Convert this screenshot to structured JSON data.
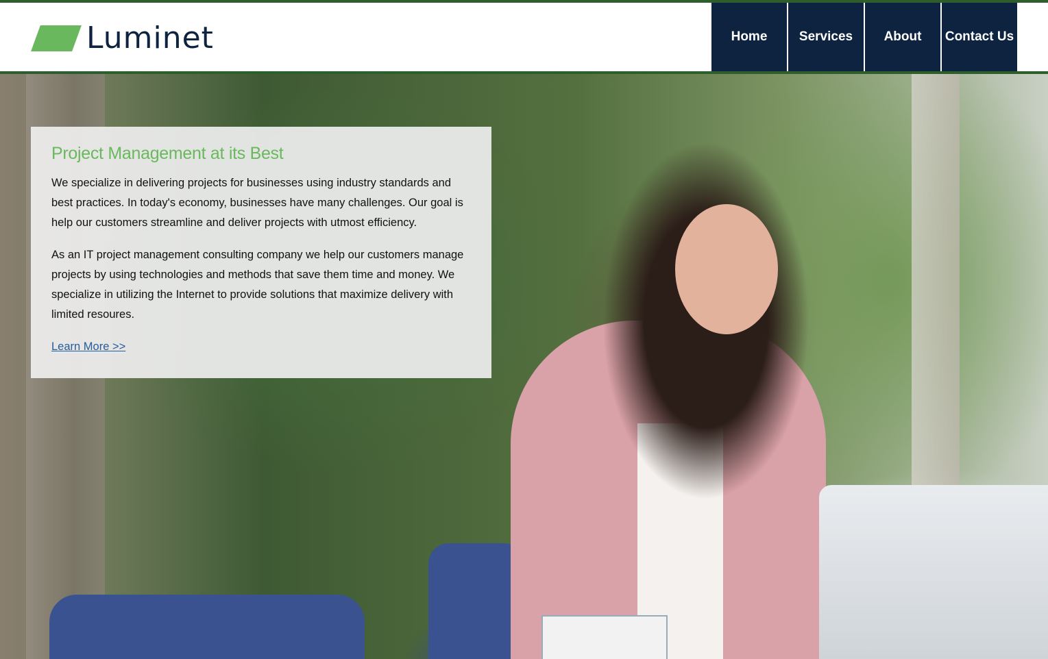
{
  "brand": {
    "name": "Luminet",
    "accent_color": "#6ab85e",
    "rule_color": "#2e5e2b",
    "nav_color": "#0d2340"
  },
  "nav": {
    "items": [
      {
        "label": "Home"
      },
      {
        "label": "Services"
      },
      {
        "label": "About"
      },
      {
        "label": "Contact Us"
      }
    ]
  },
  "hero": {
    "title": "Project Management at its Best",
    "paragraphs": [
      "We specialize in delivering projects for businesses using industry standards and best practices. In today's economy, businesses have many challenges. Our goal is help our customers streamline and deliver projects with utmost efficiency.",
      "As an IT project management consulting company we help our customers manage projects by using technologies and methods that save them time and money. We specialize in utilizing the Internet to provide solutions that maximize delivery with limited resoures."
    ],
    "link_label": "Learn More >>"
  }
}
